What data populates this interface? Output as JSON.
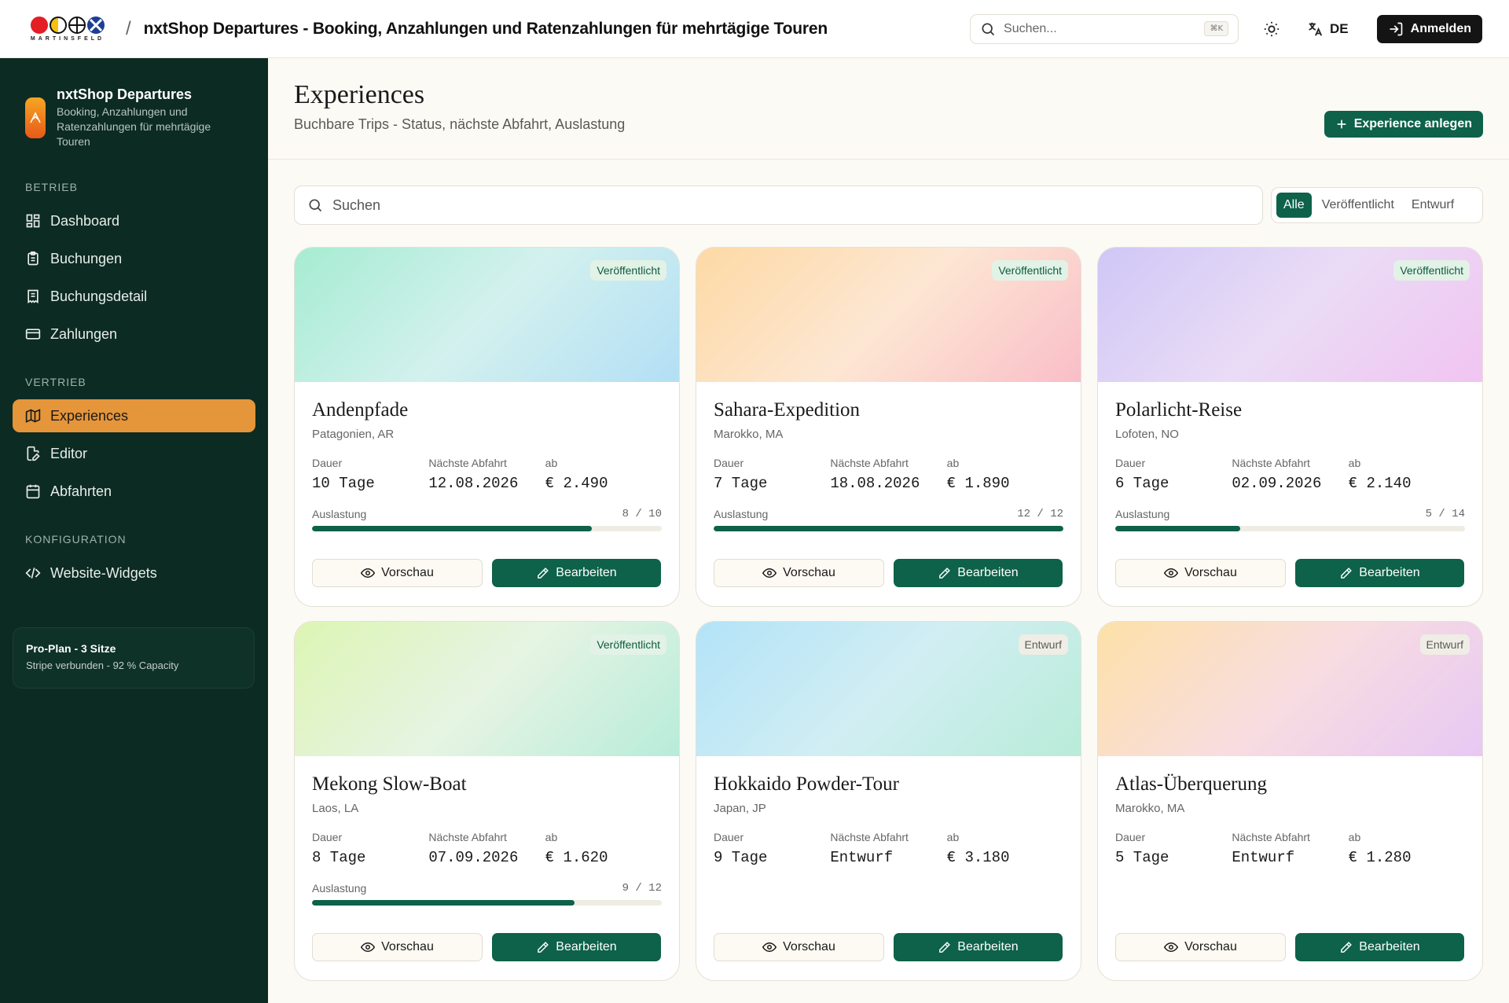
{
  "topbar": {
    "logo_text": "MARTINSFELD",
    "separator": "/",
    "title": "nxtShop Departures - Booking, Anzahlungen und Ratenzahlungen für mehrtägige Touren",
    "search_placeholder": "Suchen...",
    "search_shortcut": "⌘K",
    "language": "DE",
    "login_label": "Anmelden"
  },
  "sidebar": {
    "brand_title": "nxtShop Departures",
    "brand_subtitle": "Booking, Anzahlungen und Ratenzahlungen für mehrtägige Touren",
    "sections": [
      {
        "label": "BETRIEB",
        "items": [
          {
            "label": "Dashboard",
            "icon": "dashboard-icon"
          },
          {
            "label": "Buchungen",
            "icon": "clipboard-icon"
          },
          {
            "label": "Buchungsdetail",
            "icon": "receipt-icon"
          },
          {
            "label": "Zahlungen",
            "icon": "credit-card-icon"
          }
        ]
      },
      {
        "label": "VERTRIEB",
        "items": [
          {
            "label": "Experiences",
            "icon": "map-icon",
            "active": true
          },
          {
            "label": "Editor",
            "icon": "file-edit-icon"
          },
          {
            "label": "Abfahrten",
            "icon": "calendar-icon"
          }
        ]
      },
      {
        "label": "KONFIGURATION",
        "items": [
          {
            "label": "Website-Widgets",
            "icon": "code-icon"
          }
        ]
      }
    ],
    "plan_title": "Pro-Plan - 3 Sitze",
    "plan_subtitle": "Stripe verbunden - 92 % Capacity"
  },
  "header": {
    "title": "Experiences",
    "subtitle": "Buchbare Trips - Status, nächste Abfahrt, Auslastung",
    "create_label": "Experience anlegen"
  },
  "toolbar": {
    "search_placeholder": "Suchen",
    "filters": [
      "Alle",
      "Veröffentlicht",
      "Entwurf"
    ],
    "active_filter": "Alle"
  },
  "labels": {
    "duration": "Dauer",
    "next_departure": "Nächste Abfahrt",
    "from": "ab",
    "utilization": "Auslastung",
    "preview": "Vorschau",
    "edit": "Bearbeiten"
  },
  "colors": {
    "sidebar_bg": "#0c2b22",
    "accent_green": "#0d6249",
    "active_nav": "#e5953a"
  },
  "experiences": [
    {
      "name": "Andenpfade",
      "location": "Patagonien, AR",
      "status": "Veröffentlicht",
      "duration": "10 Tage",
      "next_departure": "12.08.2026",
      "price": "€ 2.490",
      "booked": 8,
      "capacity": 10,
      "util_text": "8 / 10",
      "gradient": [
        "#a6ecd2",
        "#d3f1ee",
        "#b3dff5"
      ]
    },
    {
      "name": "Sahara-Expedition",
      "location": "Marokko, MA",
      "status": "Veröffentlicht",
      "duration": "7 Tage",
      "next_departure": "18.08.2026",
      "price": "€ 1.890",
      "booked": 12,
      "capacity": 12,
      "util_text": "12 / 12",
      "gradient": [
        "#fdd9a4",
        "#fde7d3",
        "#f9bec8"
      ]
    },
    {
      "name": "Polarlicht-Reise",
      "location": "Lofoten, NO",
      "status": "Veröffentlicht",
      "duration": "6 Tage",
      "next_departure": "02.09.2026",
      "price": "€ 2.140",
      "booked": 5,
      "capacity": 14,
      "util_text": "5 / 14",
      "gradient": [
        "#cfc7f6",
        "#eadcf6",
        "#f1c4f1"
      ]
    },
    {
      "name": "Mekong Slow-Boat",
      "location": "Laos, LA",
      "status": "Veröffentlicht",
      "duration": "8 Tage",
      "next_departure": "07.09.2026",
      "price": "€ 1.620",
      "booked": 9,
      "capacity": 12,
      "util_text": "9 / 12",
      "gradient": [
        "#ddf5b4",
        "#e6f4e3",
        "#b8ecda"
      ]
    },
    {
      "name": "Hokkaido Powder-Tour",
      "location": "Japan, JP",
      "status": "Entwurf",
      "duration": "9 Tage",
      "next_departure": "Entwurf",
      "price": "€ 3.180",
      "util_text": "",
      "gradient": [
        "#b3e3f8",
        "#d1eef3",
        "#b9ecd8"
      ]
    },
    {
      "name": "Atlas-Überquerung",
      "location": "Marokko, MA",
      "status": "Entwurf",
      "duration": "5 Tage",
      "next_departure": "Entwurf",
      "price": "€ 1.280",
      "util_text": "",
      "gradient": [
        "#fde1a8",
        "#f8dde0",
        "#e7c8f4"
      ]
    }
  ]
}
